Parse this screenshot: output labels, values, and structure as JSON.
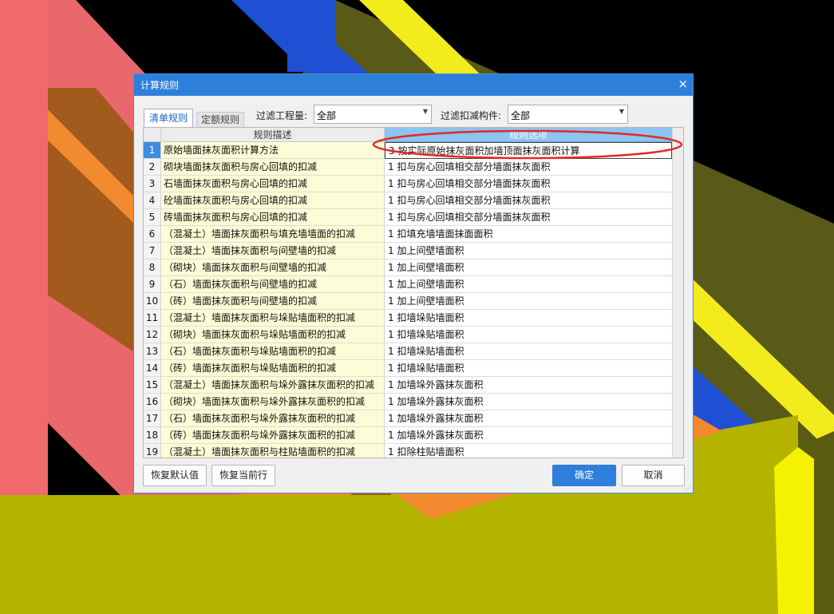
{
  "colors": {
    "title_bar": "#2e7fd9",
    "rule_desc_bg": "#fcfcd6",
    "header_selected_bg": "#8cc4f2",
    "annotation": "#e32a24"
  },
  "dialog": {
    "title": "计算规则",
    "close_icon": "×",
    "tabs": [
      {
        "label": "清单规则",
        "active": true
      },
      {
        "label": "定额规则",
        "active": false
      }
    ],
    "filter_quantity": {
      "label": "过滤工程量:",
      "value": "全部"
    },
    "filter_component": {
      "label": "过滤扣减构件:",
      "value": "全部"
    },
    "dropdown_icon": "▼",
    "table": {
      "headers": [
        "规则描述",
        "规则选项"
      ],
      "rows": [
        {
          "num": "1",
          "desc": "原始墙面抹灰面积计算方法",
          "option": "3 按实际原始抹灰面积加墙顶面抹灰面积计算"
        },
        {
          "num": "2",
          "desc": "砌块墙面抹灰面积与房心回填的扣减",
          "option": "1 扣与房心回填相交部分墙面抹灰面积"
        },
        {
          "num": "3",
          "desc": "石墙面抹灰面积与房心回填的扣减",
          "option": "1 扣与房心回填相交部分墙面抹灰面积"
        },
        {
          "num": "4",
          "desc": "砼墙面抹灰面积与房心回填的扣减",
          "option": "1 扣与房心回填相交部分墙面抹灰面积"
        },
        {
          "num": "5",
          "desc": "砖墙面抹灰面积与房心回填的扣减",
          "option": "1 扣与房心回填相交部分墙面抹灰面积"
        },
        {
          "num": "6",
          "desc": "（混凝土）墙面抹灰面积与填充墙墙面的扣减",
          "option": "1 扣填充墙墙面抹面面积"
        },
        {
          "num": "7",
          "desc": "（混凝土）墙面抹灰面积与间壁墙的扣减",
          "option": "1 加上间壁墙面积"
        },
        {
          "num": "8",
          "desc": "（砌块）墙面抹灰面积与间壁墙的扣减",
          "option": "1 加上间壁墙面积"
        },
        {
          "num": "9",
          "desc": "（石）墙面抹灰面积与间壁墙的扣减",
          "option": "1 加上间壁墙面积"
        },
        {
          "num": "10",
          "desc": "（砖）墙面抹灰面积与间壁墙的扣减",
          "option": "1 加上间壁墙面积"
        },
        {
          "num": "11",
          "desc": "（混凝土）墙面抹灰面积与垛贴墙面积的扣减",
          "option": "1 扣墙垛贴墙面积"
        },
        {
          "num": "12",
          "desc": "（砌块）墙面抹灰面积与垛贴墙面积的扣减",
          "option": "1 扣墙垛贴墙面积"
        },
        {
          "num": "13",
          "desc": "（石）墙面抹灰面积与垛贴墙面积的扣减",
          "option": "1 扣墙垛贴墙面积"
        },
        {
          "num": "14",
          "desc": "（砖）墙面抹灰面积与垛贴墙面积的扣减",
          "option": "1 扣墙垛贴墙面积"
        },
        {
          "num": "15",
          "desc": "（混凝土）墙面抹灰面积与垛外露抹灰面积的扣减",
          "option": "1 加墙垛外露抹灰面积"
        },
        {
          "num": "16",
          "desc": "（砌块）墙面抹灰面积与垛外露抹灰面积的扣减",
          "option": "1 加墙垛外露抹灰面积"
        },
        {
          "num": "17",
          "desc": "（石）墙面抹灰面积与垛外露抹灰面积的扣减",
          "option": "1 加墙垛外露抹灰面积"
        },
        {
          "num": "18",
          "desc": "（砖）墙面抹灰面积与垛外露抹灰面积的扣减",
          "option": "1 加墙垛外露抹灰面积"
        },
        {
          "num": "19",
          "desc": "（混凝土）墙面抹灰面积与柱贴墙面积的扣减",
          "option": "1 扣除柱贴墙面积"
        }
      ]
    },
    "buttons": {
      "restore_default": "恢复默认值",
      "restore_current": "恢复当前行",
      "ok": "确定",
      "cancel": "取消"
    }
  }
}
